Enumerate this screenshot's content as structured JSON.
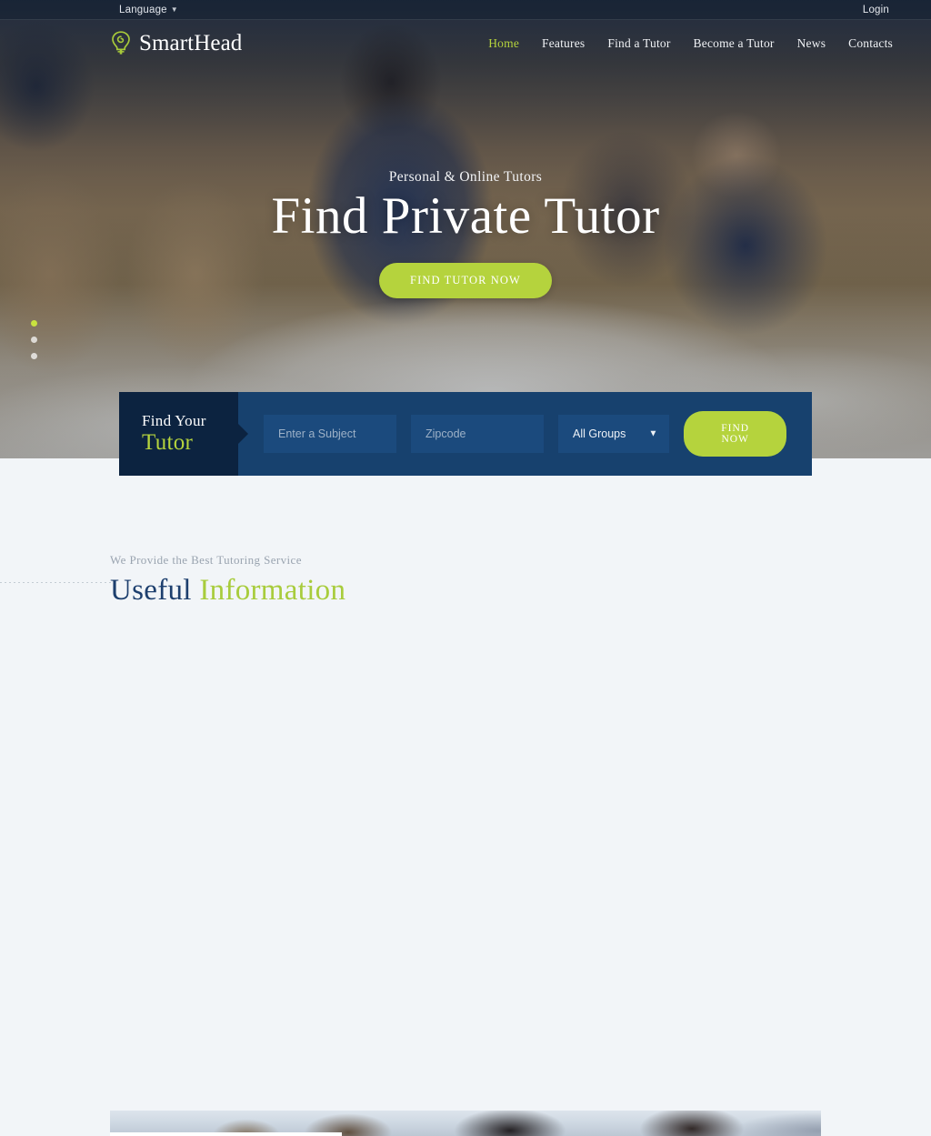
{
  "topbar": {
    "language_label": "Language",
    "language_chevron": "chevron-down-icon",
    "login_label": "Login"
  },
  "brand": {
    "name": "SmartHead",
    "mark": "lightbulb-icon",
    "accent_color": "#b5d33d"
  },
  "nav": {
    "items": [
      {
        "label": "Home",
        "active": true
      },
      {
        "label": "Features",
        "active": false
      },
      {
        "label": "Find a Tutor",
        "active": false
      },
      {
        "label": "Become a Tutor",
        "active": false
      },
      {
        "label": "News",
        "active": false
      },
      {
        "label": "Contacts",
        "active": false
      }
    ]
  },
  "hero": {
    "subtitle": "Personal & Online Tutors",
    "title": "Find Private Tutor",
    "cta_label": "FIND TUTOR NOW",
    "slider_dots": 3,
    "active_dot": 1
  },
  "search": {
    "label_line1": "Find Your",
    "label_line2": "Tutor",
    "subject_placeholder": "Enter a Subject",
    "subject_value": "",
    "zipcode_placeholder": "Zipcode",
    "zipcode_value": "",
    "group_selected": "All Groups",
    "group_options": [
      "All Groups"
    ],
    "group_chevron": "chevron-down-icon",
    "submit_label": "FIND NOW"
  },
  "info": {
    "eyebrow": "We Provide the Best Tutoring Service",
    "title_part1": "Useful",
    "title_part2": "Information"
  },
  "colors": {
    "green": "#b5d33d",
    "navy_dark": "#0c2340",
    "navy": "#17416e",
    "navy_field": "#1b4a7d",
    "heading_navy": "#1d3f6e",
    "page_bg": "#f2f5f8"
  }
}
